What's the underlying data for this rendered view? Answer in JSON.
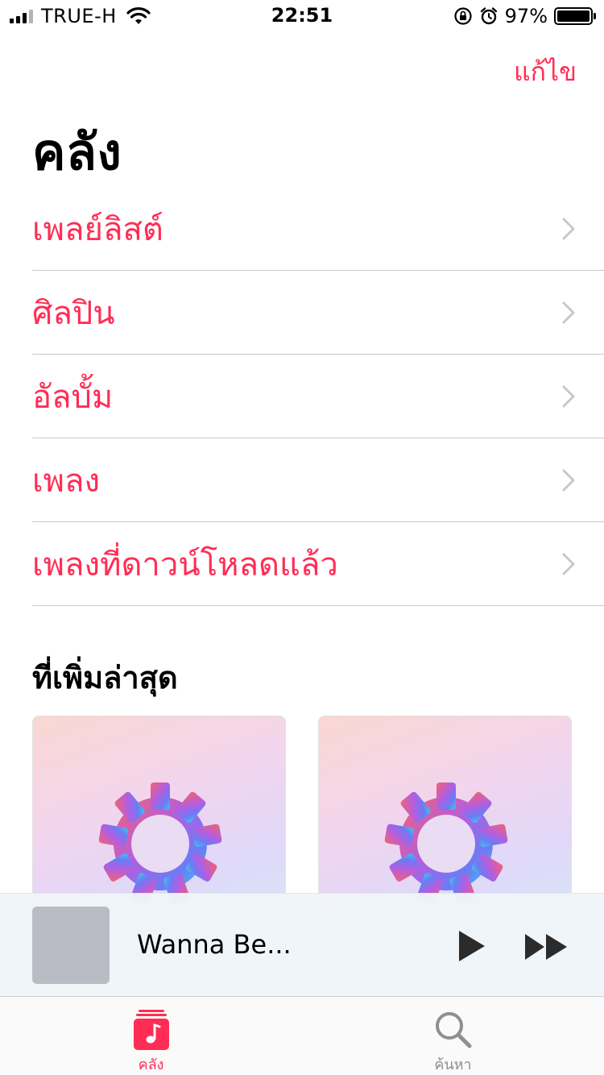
{
  "status_bar": {
    "carrier": "TRUE-H",
    "time": "22:51",
    "battery_percent": "97%"
  },
  "nav": {
    "edit_label": "แก้ไข",
    "title": "คลัง"
  },
  "library": {
    "items": [
      {
        "label": "เพลย์ลิสต์"
      },
      {
        "label": "ศิลปิน"
      },
      {
        "label": "อัลบั้ม"
      },
      {
        "label": "เพลง"
      },
      {
        "label": "เพลงที่ดาวน์โหลดแล้ว"
      }
    ]
  },
  "recently_added": {
    "title": "ที่เพิ่มล่าสุด",
    "albums": [
      {
        "icon": "gear-icon"
      },
      {
        "icon": "gear-icon"
      }
    ]
  },
  "mini_player": {
    "title": "Wanna Be..."
  },
  "tab_bar": {
    "tabs": [
      {
        "label": "คลัง",
        "icon": "music-note-icon",
        "active": true
      },
      {
        "label": "ค้นหา",
        "icon": "search-icon",
        "active": false
      }
    ]
  },
  "colors": {
    "accent": "#ff2d55",
    "separator": "#c8c7cc",
    "chevron": "#c7c7cc",
    "inactive": "#8e8e93"
  }
}
